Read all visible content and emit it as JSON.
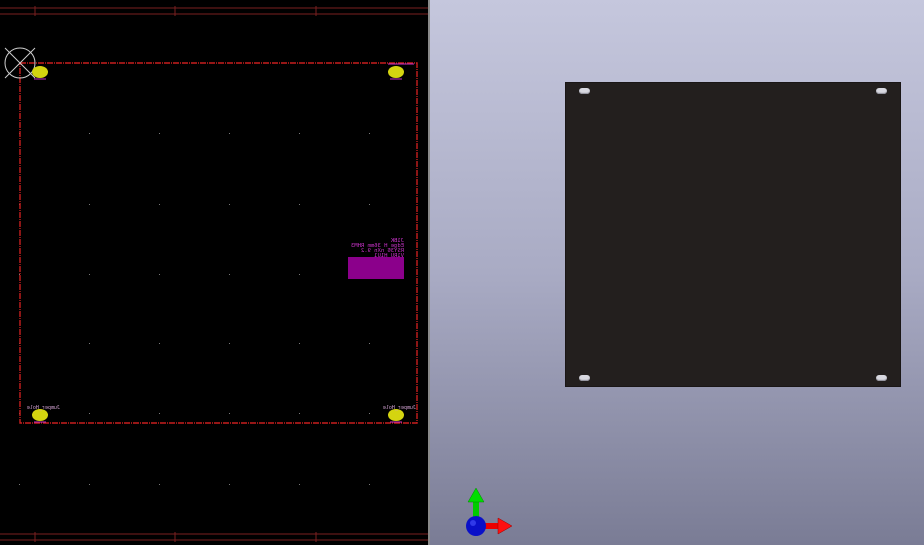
{
  "pcb_editor": {
    "component_label": {
      "lines": [
        "J1BK",
        "Edge_H 36mm RHM3",
        "RSY36 nXn 9.2",
        "V1RU H1U1"
      ]
    },
    "corner_labels": {
      "bottom_left": "Jumper_Hole",
      "bottom_right": "Jumper_Hole"
    },
    "colors": {
      "background": "#000000",
      "board_outline": "#c81e1e",
      "pads": "#d4d410",
      "silkscreen": "#c832c8",
      "courtyard": "#8b008b",
      "grid": "#6a6a6a"
    }
  },
  "viewer_3d": {
    "colors": {
      "board": "#231f1e",
      "background_top": "#c5c7dd",
      "background_bottom": "#7a7c95",
      "axis_x": "#ff0000",
      "axis_y": "#00cc00",
      "axis_z": "#0000cc"
    },
    "axis_icons": [
      "x-axis-arrow-icon",
      "y-axis-arrow-icon",
      "z-axis-dot-icon"
    ]
  }
}
